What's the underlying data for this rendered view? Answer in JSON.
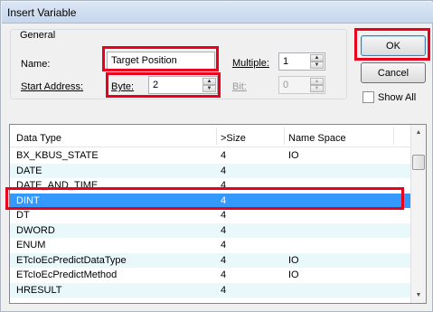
{
  "window": {
    "title": "Insert Variable"
  },
  "general": {
    "legend": "General",
    "name_label": "Name:",
    "name_value": "Target Position",
    "start_address_label": "Start Address:",
    "byte_label": "Byte:",
    "byte_value": "2",
    "bit_label": "Bit:",
    "bit_value": "0",
    "multiple_label": "Multiple:",
    "multiple_value": "1"
  },
  "buttons": {
    "ok": "OK",
    "cancel": "Cancel"
  },
  "show_all": {
    "label": "Show All",
    "checked": false
  },
  "list": {
    "columns": [
      "Data Type",
      ">Size",
      "Name Space"
    ],
    "rows": [
      {
        "type": "BX_KBUS_STATE",
        "size": "4",
        "ns": "IO"
      },
      {
        "type": "DATE",
        "size": "4",
        "ns": ""
      },
      {
        "type": "DATE_AND_TIME",
        "size": "4",
        "ns": ""
      },
      {
        "type": "DINT",
        "size": "4",
        "ns": "",
        "selected": true
      },
      {
        "type": "DT",
        "size": "4",
        "ns": ""
      },
      {
        "type": "DWORD",
        "size": "4",
        "ns": ""
      },
      {
        "type": "ENUM",
        "size": "4",
        "ns": ""
      },
      {
        "type": "ETcIoEcPredictDataType",
        "size": "4",
        "ns": "IO"
      },
      {
        "type": "ETcIoEcPredictMethod",
        "size": "4",
        "ns": "IO"
      },
      {
        "type": "HRESULT",
        "size": "4",
        "ns": ""
      }
    ]
  },
  "icons": {
    "spin_up": "triangle-up-icon",
    "spin_down": "triangle-down-icon",
    "scroll_up": "scroll-up-arrow-icon",
    "scroll_down": "scroll-down-arrow-icon"
  },
  "colors": {
    "highlight": "#e8001c",
    "selection": "#3399ff",
    "alt_row": "#e8f8fb"
  }
}
